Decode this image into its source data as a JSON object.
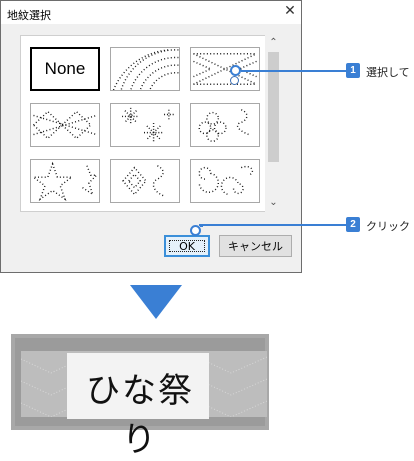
{
  "dialog": {
    "title": "地紋選択",
    "close_glyph": "✕",
    "none_label": "None",
    "scroll_up": "⌃",
    "scroll_down": "⌄",
    "ok_label": "OK",
    "cancel_label": "キャンセル"
  },
  "callouts": [
    {
      "number": "1",
      "text": "選択して"
    },
    {
      "number": "2",
      "text": "クリック"
    }
  ],
  "result": {
    "text": "ひな祭り"
  },
  "colors": {
    "accent": "#3a7fd4"
  }
}
